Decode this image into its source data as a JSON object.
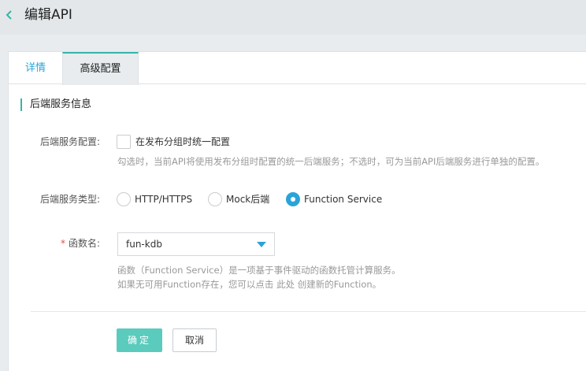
{
  "header": {
    "title": "编辑API",
    "back_icon": "chevron-left-icon"
  },
  "tabs": [
    {
      "label": "详情",
      "active": false
    },
    {
      "label": "高级配置",
      "active": true
    }
  ],
  "section": {
    "title": "后端服务信息"
  },
  "form": {
    "backend_config": {
      "label": "后端服务配置:",
      "checkbox_label": "在发布分组时统一配置",
      "checked": false,
      "hint": "勾选时，当前API将使用发布分组时配置的统一后端服务；不选时，可为当前API后端服务进行单独的配置。"
    },
    "backend_type": {
      "label": "后端服务类型:",
      "options": [
        {
          "label": "HTTP/HTTPS",
          "selected": false
        },
        {
          "label": "Mock后端",
          "selected": false
        },
        {
          "label": "Function Service",
          "selected": true
        }
      ]
    },
    "function_name": {
      "required_mark": "*",
      "label": "函数名:",
      "value": "fun-kdb",
      "hint_line1": "函数（Function Service）是一项基于事件驱动的函数托管计算服务。",
      "hint_line2": "如果无可用Function存在，您可以点击 此处 创建新的Function。"
    }
  },
  "buttons": {
    "ok": "确定",
    "cancel": "取消"
  },
  "colors": {
    "accent": "#37b5a9",
    "link": "#2aa4d8",
    "ok_button": "#5bcbbe",
    "required": "#e54d42"
  }
}
